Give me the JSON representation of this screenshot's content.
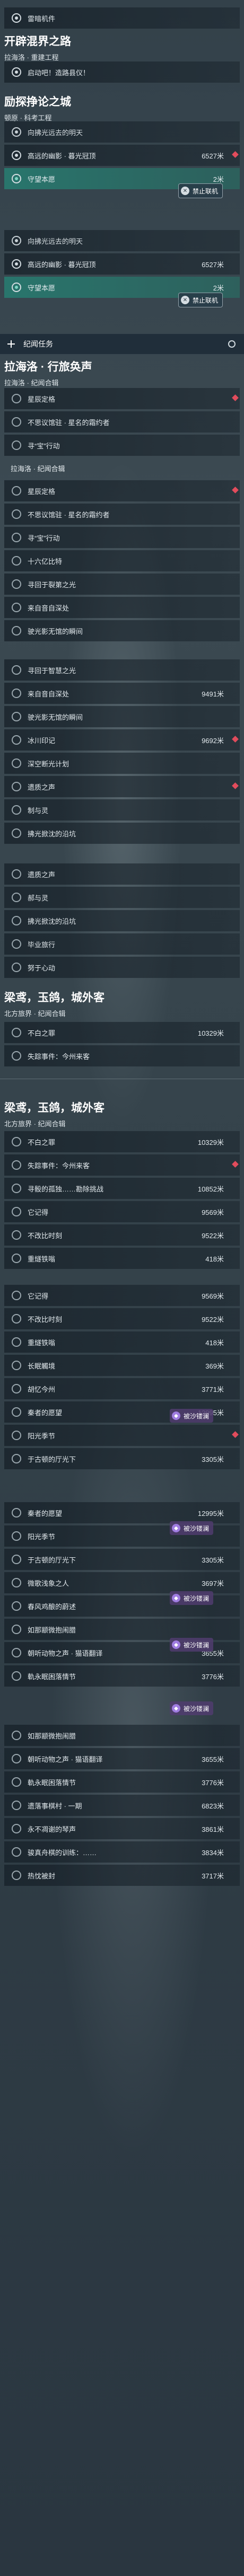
{
  "colors": {
    "accent": "#2a7a6e",
    "alert": "#e24c5c",
    "badge": "#9f7ce0"
  },
  "icons": {
    "objective": "circle-marker-icon",
    "alert": "red-diamond-icon",
    "collapse": "plus-icon",
    "settings": "gear-icon",
    "multiplayer_disabled": "no-multiplayer-icon",
    "quest_badge": "deathless-icon"
  },
  "b1": {
    "r0": "雷暗机件"
  },
  "h1": {
    "title": "开辟混界之路",
    "sub": "拉海洛 · 重建工程"
  },
  "h1rows": [
    "启动吧！造路县仪！"
  ],
  "h2": {
    "title": "励探挣论之城",
    "sub": "顿原 · 科考工程"
  },
  "h2rows": [
    {
      "label": "向拂光远去的明天",
      "dist": ""
    },
    {
      "label": "高远的幽影 · 暮光冠顶",
      "dist": "6527米"
    },
    {
      "label": "守望本愿",
      "dist": "2米"
    }
  ],
  "h2b": [
    {
      "label": "向拂光远去的明天",
      "dist": ""
    },
    {
      "label": "高远的幽影 · 暮光冠顶",
      "dist": "6527米"
    },
    {
      "label": "守望本愿",
      "dist": "2米"
    }
  ],
  "tab1": "纪闻任务",
  "h3": {
    "title": "拉海洛 · 行旅奂声",
    "sub": "拉海洛 · 纪闻合辑"
  },
  "h3rows": [
    "星辰定格",
    "不思议馆驻 · 星名的霜约者",
    "寻“宝”行动"
  ],
  "h3sub": "拉海洛 · 纪闻合辑",
  "h4rows": [
    {
      "label": "星辰定格",
      "dist": ""
    },
    {
      "label": "不思议馆驻 · 星名的霜约者",
      "dist": ""
    },
    {
      "label": "寻“宝”行动",
      "dist": ""
    },
    {
      "label": "十六亿比特",
      "dist": ""
    },
    {
      "label": "寻回于裂第之光",
      "dist": ""
    },
    {
      "label": "来自音自深处",
      "dist": ""
    },
    {
      "label": "驶光影无馆的瞬间",
      "dist": ""
    }
  ],
  "h5rows": [
    {
      "label": "寻回于智慧之光",
      "dist": ""
    },
    {
      "label": "来自音自深处",
      "dist": "9491米"
    },
    {
      "label": "驶光影无馆的瞬间",
      "dist": ""
    },
    {
      "label": "冰川印记",
      "dist": "9692米"
    },
    {
      "label": "深空断光计划",
      "dist": ""
    },
    {
      "label": "遗质之声",
      "dist": ""
    },
    {
      "label": "制与灵",
      "dist": ""
    },
    {
      "label": "拂光掀沈的沿坑",
      "dist": ""
    }
  ],
  "h6rows": [
    {
      "label": "遗质之声",
      "dist": ""
    },
    {
      "label": "郝与灵",
      "dist": ""
    },
    {
      "label": "拂光掀沈的沿坑",
      "dist": ""
    },
    {
      "label": "毕业旅行",
      "dist": ""
    },
    {
      "label": "努于心动",
      "dist": ""
    }
  ],
  "h7": {
    "title": "梁鸢，玉鸽，城外客",
    "sub": "北方旅界 · 纪闻合辑"
  },
  "h7rows": [
    {
      "label": "不白之罪",
      "dist": "10329米"
    },
    {
      "label": "失踪事件：今州来客",
      "dist": ""
    }
  ],
  "h8": {
    "title": "梁鸢，玉鸽，城外客",
    "sub": "北方旅界 · 纪闻合辑"
  },
  "h8rows": [
    {
      "label": "不白之罪",
      "dist": "10329米"
    },
    {
      "label": "失踪事件：今州来客",
      "dist": ""
    },
    {
      "label": "寻骰的孤独……勘除挑战",
      "dist": "10852米"
    },
    {
      "label": "它记得",
      "dist": "9569米"
    },
    {
      "label": "不改比时刻",
      "dist": "9522米"
    },
    {
      "label": "重燧铁嗡",
      "dist": "418米"
    }
  ],
  "h9rows": [
    {
      "label": "它记得",
      "dist": "9569米"
    },
    {
      "label": "不改比时刻",
      "dist": "9522米"
    },
    {
      "label": "重燧铁嗡",
      "dist": "418米"
    },
    {
      "label": "长眠觸境",
      "dist": "369米"
    },
    {
      "label": "胡忆今州",
      "dist": "3771米"
    },
    {
      "label": "秦者的愿望",
      "dist": "12995米"
    },
    {
      "label": "阳光季节",
      "dist": ""
    },
    {
      "label": "于古顿的厅光下",
      "dist": "3305米"
    }
  ],
  "h10rows": [
    {
      "label": "秦者的愿望",
      "dist": "12995米"
    },
    {
      "label": "阳光季节",
      "dist": ""
    },
    {
      "label": "于古顿的厅光下",
      "dist": "3305米"
    },
    {
      "label": "微歌浅象之人",
      "dist": "3697米"
    },
    {
      "label": "春风鸡酿的蔚述",
      "dist": ""
    },
    {
      "label": "如那颛微抱闹腊",
      "dist": ""
    },
    {
      "label": "朝听动物之声 · 猫语翻译",
      "dist": "3655米"
    },
    {
      "label": "軌永眠困落情节",
      "dist": "3776米"
    }
  ],
  "h11rows": [
    {
      "label": "如那颛微抱闹腊",
      "dist": ""
    },
    {
      "label": "朝听动物之声 · 猫语翻译",
      "dist": "3655米"
    },
    {
      "label": "軌永眠困落情节",
      "dist": "3776米"
    },
    {
      "label": "遗落事棋村 · 一期",
      "dist": "6823米"
    },
    {
      "label": "永不凋谢的琴声",
      "dist": "3861米"
    },
    {
      "label": "骏真舟棋的训练：……",
      "dist": "3834米"
    },
    {
      "label": "热忱被封",
      "dist": "3717米"
    }
  ],
  "badges": {
    "disabled": "禁止联机",
    "quest": "被沙镂澜"
  }
}
